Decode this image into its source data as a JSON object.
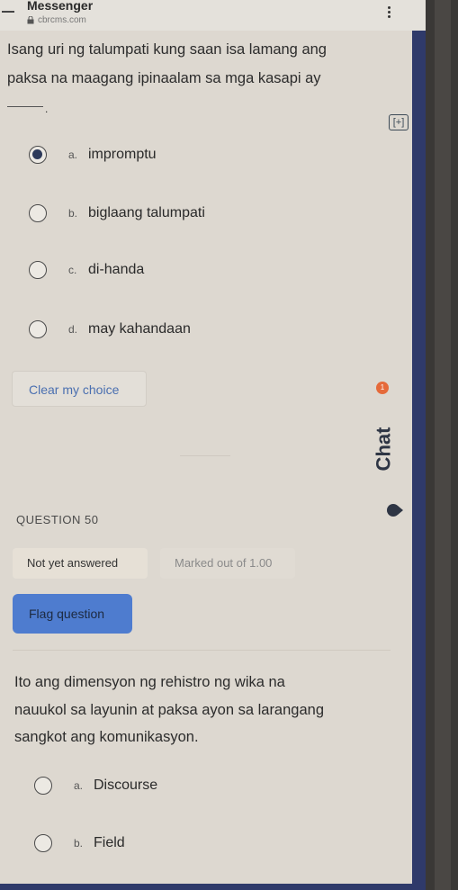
{
  "header": {
    "app_title": "Messenger",
    "url": "cbrcms.com"
  },
  "question49": {
    "text_lines": [
      "Isang uri ng talumpati kung saan isa lamang ang",
      "paksa na maagang ipinaalam sa mga kasapi ay"
    ],
    "blank_suffix": ".",
    "options": [
      {
        "letter": "a.",
        "text": "impromptu",
        "selected": true
      },
      {
        "letter": "b.",
        "text": "biglaang talumpati",
        "selected": false
      },
      {
        "letter": "c.",
        "text": "di-handa",
        "selected": false
      },
      {
        "letter": "d.",
        "text": "may kahandaan",
        "selected": false
      }
    ],
    "clear_label": "Clear my choice"
  },
  "question50": {
    "label": "QUESTION 50",
    "status": "Not yet answered",
    "marked": "Marked out of 1.00",
    "flag_label": "Flag question",
    "text_lines": [
      "Ito ang dimensyon ng rehistro ng wika na",
      "nauukol sa layunin at paksa ayon sa larangang",
      "sangkot ang komunikasyon."
    ],
    "options": [
      {
        "letter": "a.",
        "text": "Discourse",
        "selected": false
      },
      {
        "letter": "b.",
        "text": "Field",
        "selected": false
      }
    ]
  },
  "chat": {
    "label": "Chat",
    "badge": "1"
  },
  "colors": {
    "accent": "#4e7ccf",
    "side_strip": "#2f3a6a",
    "link": "#4a6fb0"
  }
}
